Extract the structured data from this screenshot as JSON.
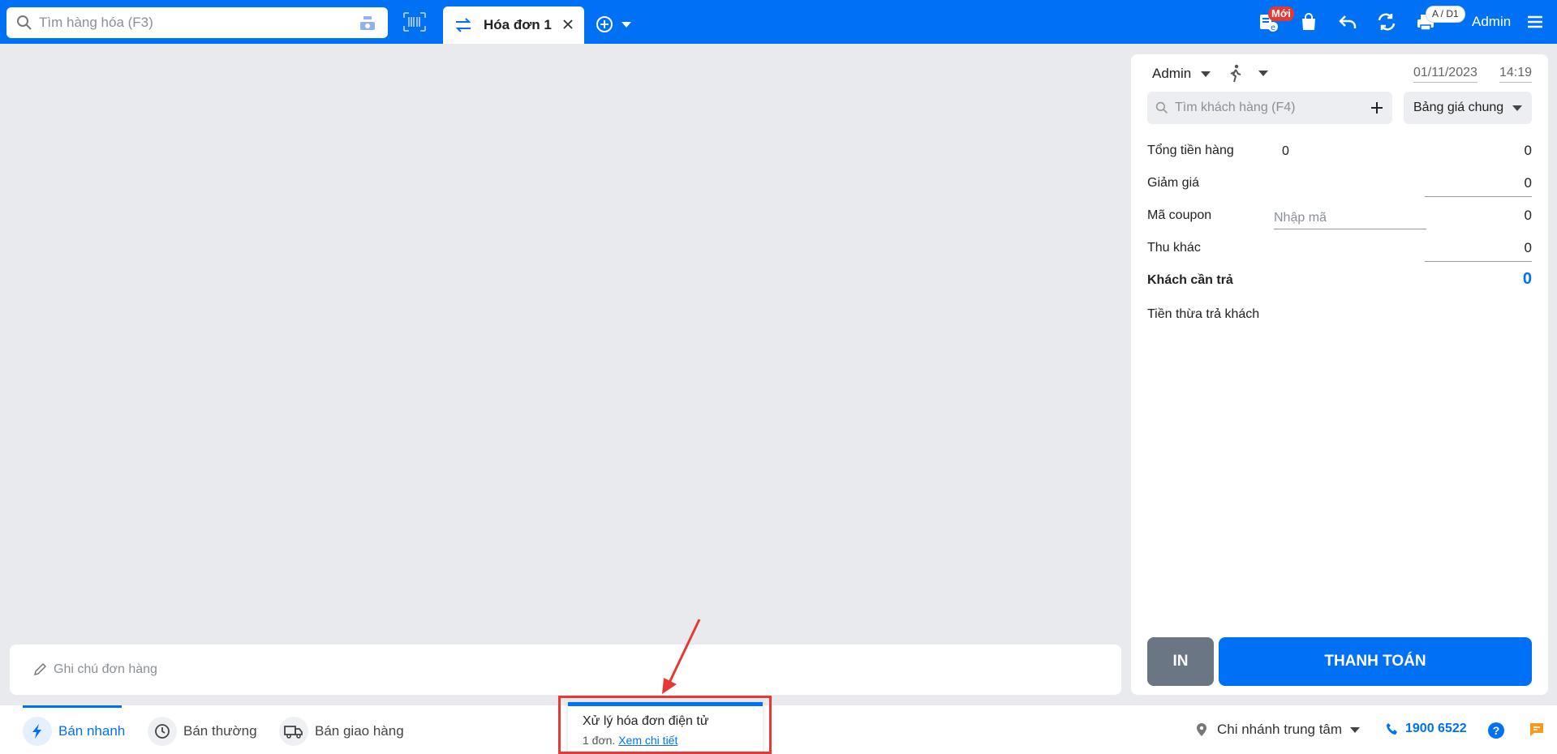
{
  "topbar": {
    "search_placeholder": "Tìm hàng hóa (F3)",
    "tab_label": "Hóa đơn 1",
    "new_badge": "Mới",
    "printer_badge": "A / D1",
    "user": "Admin",
    "brand_color": "#0070f4",
    "icons": [
      "search-icon",
      "scale-icon",
      "barcode-icon",
      "swap-icon",
      "close-icon",
      "add-tab-icon",
      "chevron-down-icon",
      "e-invoice-icon",
      "shopping-bag-icon",
      "undo-icon",
      "refresh-icon",
      "printer-icon",
      "menu-icon"
    ]
  },
  "panel": {
    "staff": "Admin",
    "date": "01/11/2023",
    "time": "14:19",
    "customer_search_placeholder": "Tìm khách hàng (F4)",
    "price_list": "Bảng giá chung",
    "rows": {
      "total_label": "Tổng tiền hàng",
      "total_qty": "0",
      "total_value": "0",
      "discount_label": "Giảm giá",
      "discount_value": "0",
      "coupon_label": "Mã coupon",
      "coupon_placeholder": "Nhập mã",
      "coupon_value": "0",
      "other_label": "Thu khác",
      "other_value": "0",
      "payable_label": "Khách cần trả",
      "payable_value": "0",
      "change_label": "Tiền thừa trả khách"
    },
    "print_button": "IN",
    "pay_button": "THANH TOÁN"
  },
  "note": {
    "placeholder": "Ghi chú đơn hàng"
  },
  "bottom": {
    "nav": [
      "Bán nhanh",
      "Bán thường",
      "Bán giao hàng"
    ],
    "branch": "Chi nhánh trung tâm",
    "phone": "1900 6522"
  },
  "toast": {
    "title": "Xử lý hóa đơn điện tử",
    "count_text": "1 đơn.",
    "link": "Xem chi tiết"
  },
  "highlight_color": "#e53935"
}
